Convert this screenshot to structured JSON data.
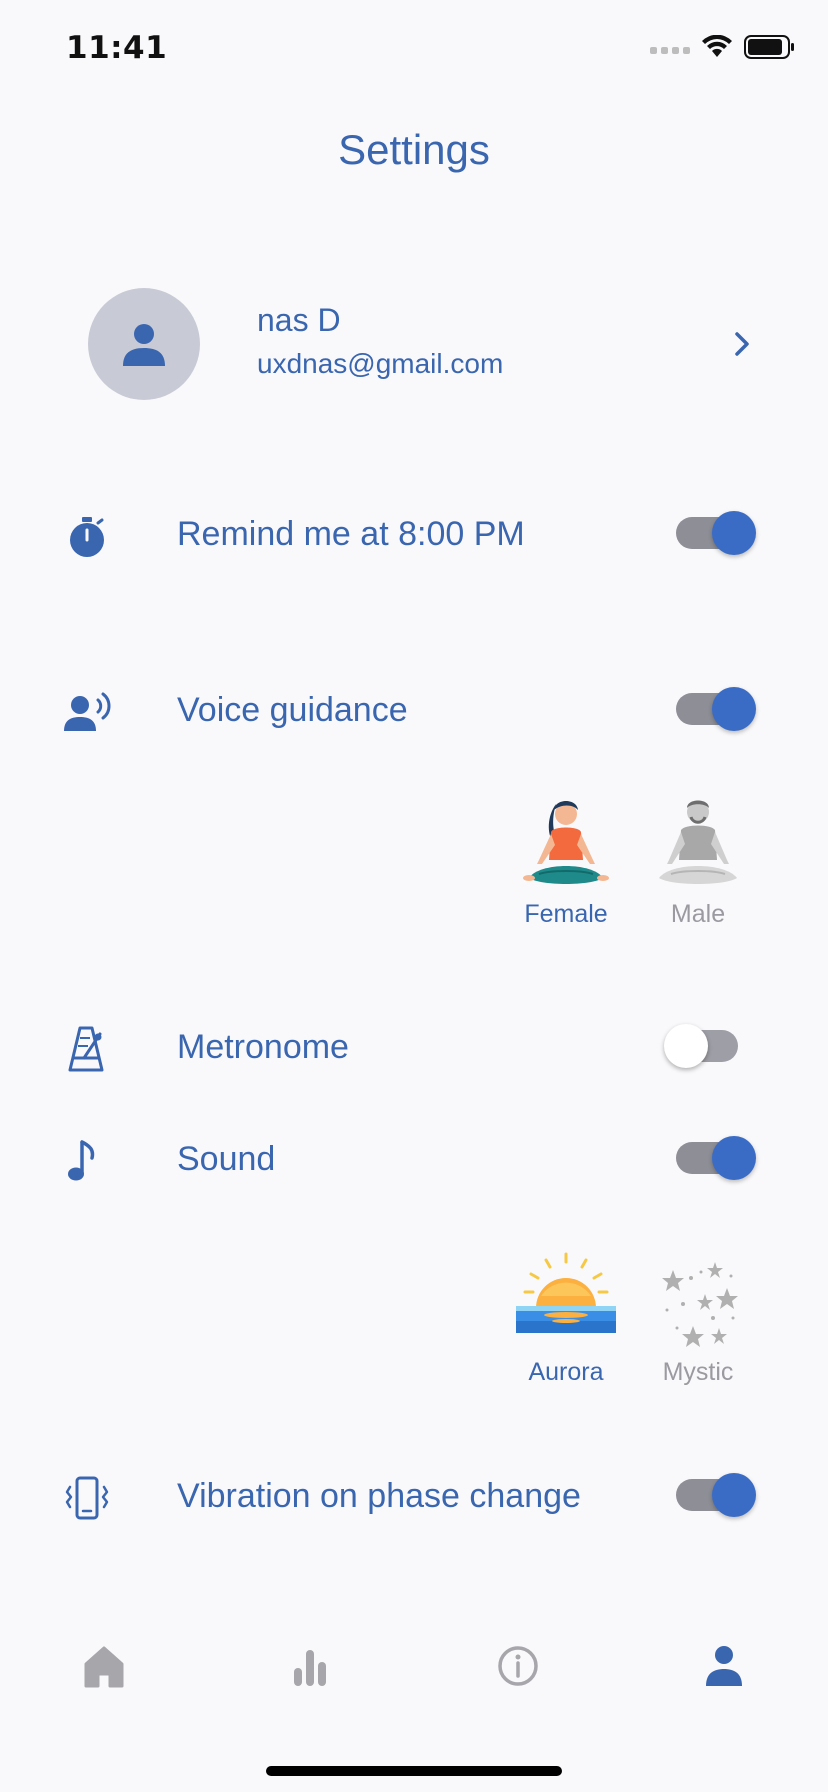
{
  "status_bar": {
    "time": "11:41"
  },
  "header": {
    "title": "Settings"
  },
  "profile": {
    "name": "nas D",
    "email": "uxdnas@gmail.com"
  },
  "settings": {
    "reminder": {
      "label": "Remind me at 8:00 PM",
      "enabled": true,
      "icon": "stopwatch-icon"
    },
    "voice_guidance": {
      "label": "Voice guidance",
      "enabled": true,
      "icon": "voice-icon",
      "options": [
        {
          "label": "Female",
          "selected": true
        },
        {
          "label": "Male",
          "selected": false
        }
      ]
    },
    "metronome": {
      "label": "Metronome",
      "enabled": false,
      "icon": "metronome-icon"
    },
    "sound": {
      "label": "Sound",
      "enabled": true,
      "icon": "music-note-icon",
      "options": [
        {
          "label": "Aurora",
          "selected": true
        },
        {
          "label": "Mystic",
          "selected": false
        }
      ]
    },
    "vibration": {
      "label": "Vibration on phase change",
      "enabled": true,
      "icon": "vibration-icon"
    }
  },
  "tab_bar": {
    "tabs": [
      {
        "name": "home",
        "icon": "home-icon",
        "active": false
      },
      {
        "name": "stats",
        "icon": "bar-chart-icon",
        "active": false
      },
      {
        "name": "info",
        "icon": "info-icon",
        "active": false
      },
      {
        "name": "profile",
        "icon": "person-icon",
        "active": true
      }
    ]
  },
  "colors": {
    "accent": "#3a66b0",
    "toggle_knob": "#3a6cc6",
    "inactive": "#9a9aa0",
    "avatar_bg": "#c8cbd6"
  }
}
